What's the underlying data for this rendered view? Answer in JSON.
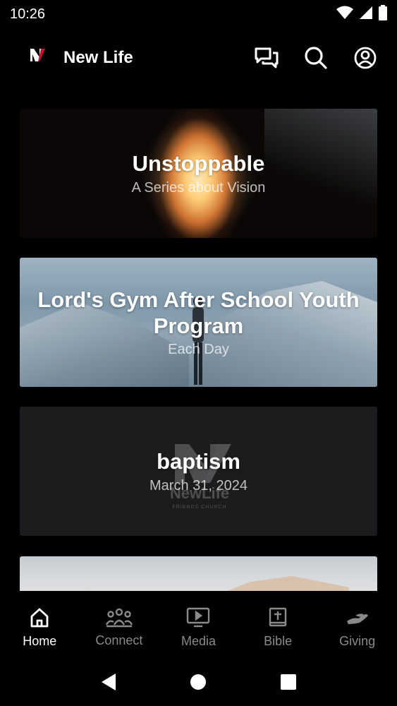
{
  "status_bar": {
    "time": "10:26"
  },
  "header": {
    "logo_text": "NewLife",
    "title": "New Life"
  },
  "cards": [
    {
      "title": "Unstoppable",
      "subtitle": "A Series about Vision"
    },
    {
      "title": "Lord's Gym After School Youth Program",
      "subtitle": "Each Day"
    },
    {
      "title": "baptism",
      "subtitle": "March 31, 2024",
      "watermark_text": "NewLife",
      "watermark_sub": "FRIENDS CHURCH"
    },
    {
      "title": "",
      "subtitle": ""
    }
  ],
  "tabs": [
    {
      "label": "Home",
      "icon": "home-icon",
      "active": true
    },
    {
      "label": "Connect",
      "icon": "people-icon",
      "active": false
    },
    {
      "label": "Media",
      "icon": "play-screen-icon",
      "active": false
    },
    {
      "label": "Bible",
      "icon": "bible-icon",
      "active": false
    },
    {
      "label": "Giving",
      "icon": "giving-hand-icon",
      "active": false
    }
  ],
  "colors": {
    "background": "#000000",
    "card_dark": "#1c1b1d",
    "tab_inactive": "#8a8a8a",
    "tab_active": "#ffffff"
  }
}
